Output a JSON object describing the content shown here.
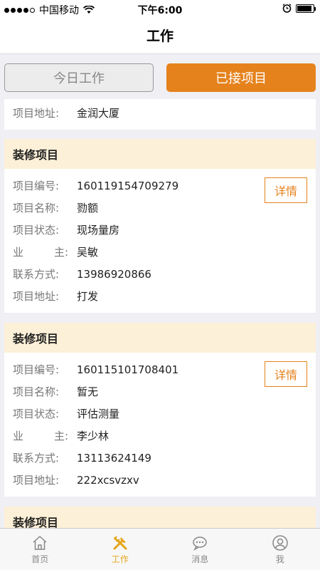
{
  "status_bar": {
    "carrier": "中国移动",
    "time": "下午6:00",
    "battery_level": 0.9
  },
  "nav": {
    "title": "工作"
  },
  "tabs": [
    {
      "label": "今日工作",
      "selected": false
    },
    {
      "label": "已接项目",
      "selected": true
    }
  ],
  "colors": {
    "accent": "#e5821c",
    "header_bg": "#fdf0d8",
    "active_tab": "#e5a419"
  },
  "labels": {
    "code": "项目编号:",
    "name": "项目名称:",
    "status": "项目状态:",
    "owner_a": "业",
    "owner_b": "主:",
    "contact": "联系方式:",
    "address": "项目地址:",
    "detail": "详情",
    "card_header": "装修项目"
  },
  "partial_card": {
    "address": "金润大厦"
  },
  "projects": [
    {
      "code": "160119154709279",
      "name": "勠额",
      "status": "现场量房",
      "owner": "吴敏",
      "contact": "13986920866",
      "address": "打发"
    },
    {
      "code": "160115101708401",
      "name": "暂无",
      "status": "评估测量",
      "owner": "李少林",
      "contact": "13113624149",
      "address": "222xcsvzxv"
    }
  ],
  "tab_bar": [
    {
      "label": "首页",
      "icon": "home-icon",
      "active": false
    },
    {
      "label": "工作",
      "icon": "tools-icon",
      "active": true
    },
    {
      "label": "消息",
      "icon": "message-icon",
      "active": false
    },
    {
      "label": "我",
      "icon": "user-icon",
      "active": false
    }
  ]
}
